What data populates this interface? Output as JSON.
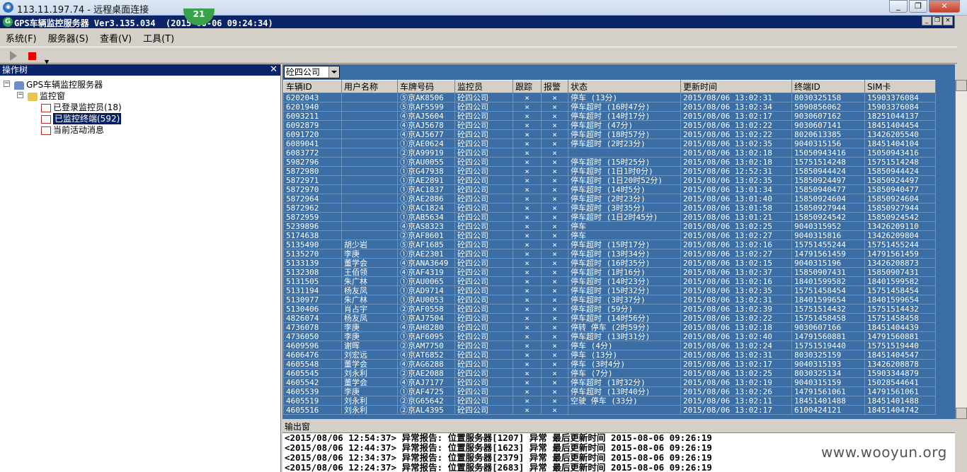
{
  "rdp": {
    "title": "113.11.197.74 - 远程桌面连接",
    "min": "_",
    "restore": "❐",
    "close": "✕"
  },
  "badge": "21",
  "app": {
    "title": "GPS车辆监控服务器 Ver3.135.034  (2015-08-06 09:24:34)"
  },
  "menu": [
    "系统(F)",
    "服务器(S)",
    "查看(V)",
    "工具(T)"
  ],
  "tree": {
    "header": "操作树",
    "root": "GPS车辆监控服务器",
    "monitor": "监控窗",
    "children": [
      "已登录监控员(18)",
      "已监控终端(592)",
      "当前活动消息"
    ]
  },
  "filter": {
    "company": "砼四公司"
  },
  "grid": {
    "columns": [
      "车辆ID",
      "用户名称",
      "车牌号码",
      "监控员",
      "跟踪",
      "报警",
      "状态",
      "更新时间",
      "终端ID",
      "SIM卡"
    ],
    "rows": [
      [
        "6202043",
        "",
        "⑤京AK8506",
        "砼四公司",
        "×",
        "×",
        "停车 (13分)",
        "2015/08/06 13:02:31",
        "8030325158",
        "15903376084"
      ],
      [
        "6201940",
        "",
        "⑤京AF5599",
        "砼四公司",
        "×",
        "×",
        "停车超时 (16时47分)",
        "2015/08/06 13:02:34",
        "5090856062",
        "15903376084"
      ],
      [
        "6093211",
        "",
        "④京AJ5604",
        "砼四公司",
        "×",
        "×",
        "停车超时 (14时17分)",
        "2015/08/06 13:02:17",
        "9030607162",
        "18251044137"
      ],
      [
        "6092879",
        "",
        "④京AJ5678",
        "砼四公司",
        "×",
        "×",
        "停车超时 (47分)",
        "2015/08/06 13:02:22",
        "9030607141",
        "18451404454"
      ],
      [
        "6091720",
        "",
        "④京AJ5677",
        "砼四公司",
        "×",
        "×",
        "停车超时 (18时57分)",
        "2015/08/06 13:02:22",
        "8020613385",
        "13426205540"
      ],
      [
        "6089041",
        "",
        "①京AE0624",
        "砼四公司",
        "×",
        "×",
        "停车超时 (2时23分)",
        "2015/08/06 13:02:35",
        "9040315156",
        "18451404104"
      ],
      [
        "6083772",
        "",
        "②京A99919",
        "砼四公司",
        "×",
        "×",
        "",
        "2015/08/06 13:02:18",
        "15050943416",
        "15050943416"
      ],
      [
        "5982796",
        "",
        "①京AU0055",
        "砼四公司",
        "×",
        "×",
        "停车超时 (15时25分)",
        "2015/08/06 13:02:18",
        "15751514248",
        "15751514248"
      ],
      [
        "5872980",
        "",
        "①京G47938",
        "砼四公司",
        "×",
        "×",
        "停车超时 (1日1时0分)",
        "2015/08/06 12:52:31",
        "15850944424",
        "15850944424"
      ],
      [
        "5872971",
        "",
        "①京AE2891",
        "砼四公司",
        "×",
        "×",
        "停车超时 (1日20时52分)",
        "2015/08/06 13:02:35",
        "15850924497",
        "15850924497"
      ],
      [
        "5872970",
        "",
        "①京AC1837",
        "砼四公司",
        "×",
        "×",
        "停车超时 (14时5分)",
        "2015/08/06 13:01:34",
        "15850940477",
        "15850940477"
      ],
      [
        "5872964",
        "",
        "①京AE2886",
        "砼四公司",
        "×",
        "×",
        "停车超时 (2时23分)",
        "2015/08/06 13:01:40",
        "15850924604",
        "15850924604"
      ],
      [
        "5872962",
        "",
        "①京AC1824",
        "砼四公司",
        "×",
        "×",
        "停车超时 (3时35分)",
        "2015/08/06 13:01:58",
        "15850927944",
        "15850927944"
      ],
      [
        "5872959",
        "",
        "①京AB5634",
        "砼四公司",
        "×",
        "×",
        "停车超时 (1日2时45分)",
        "2015/08/06 13:01:21",
        "15850924542",
        "15850924542"
      ],
      [
        "5239896",
        "",
        "④京AS8323",
        "砼四公司",
        "×",
        "×",
        "停车",
        "2015/08/06 13:02:25",
        "9040315952",
        "13426209110"
      ],
      [
        "5174638",
        "",
        "②京AF8601",
        "砼四公司",
        "×",
        "×",
        "停车",
        "2015/08/06 13:02:27",
        "9040315816",
        "13426209804"
      ],
      [
        "5135490",
        "胡少岩",
        "⑤京AF1685",
        "砼四公司",
        "×",
        "×",
        "停车超时 (15时17分)",
        "2015/08/06 13:02:16",
        "15751455244",
        "15751455244"
      ],
      [
        "5135270",
        "李庚",
        "①京AE2301",
        "砼四公司",
        "×",
        "×",
        "停车超时 (13时34分)",
        "2015/08/06 13:02:27",
        "14791561459",
        "14791561459"
      ],
      [
        "5133139",
        "董学会",
        "④京ANA3649",
        "砼四公司",
        "×",
        "×",
        "停车超时 (16时35分)",
        "2015/08/06 13:02:15",
        "9040315196",
        "13426208873"
      ],
      [
        "5132308",
        "王佰领",
        "④京AF4319",
        "砼四公司",
        "×",
        "×",
        "停车超时 (1时16分)",
        "2015/08/06 13:02:37",
        "15850907431",
        "15850907431"
      ],
      [
        "5131505",
        "朱广林",
        "①京AU0065",
        "砼四公司",
        "×",
        "×",
        "停车超时 (14时23分)",
        "2015/08/06 13:02:16",
        "18401599582",
        "18401599582"
      ],
      [
        "5131194",
        "杨友凤",
        "①京AD9714",
        "砼四公司",
        "×",
        "×",
        "停车超时 (15时32分)",
        "2015/08/06 13:02:35",
        "15751458454",
        "15751458454"
      ],
      [
        "5130977",
        "朱广林",
        "①京AU0053",
        "砼四公司",
        "×",
        "×",
        "停车超时 (3时37分)",
        "2015/08/06 13:02:31",
        "18401599654",
        "18401599654"
      ],
      [
        "5130406",
        "肖占宇",
        "②京AF0558",
        "砼四公司",
        "×",
        "×",
        "停车超时 (59分)",
        "2015/08/06 13:02:39",
        "15751514432",
        "15751514432"
      ],
      [
        "4826074",
        "杨友凤",
        "①京AJ7504",
        "砼四公司",
        "×",
        "×",
        "停车超时 (14时56分)",
        "2015/08/06 13:02:22",
        "15751458458",
        "15751458458"
      ],
      [
        "4736078",
        "李庚",
        "④京AH8280",
        "砼四公司",
        "×",
        "×",
        "停转 停车 (2时59分)",
        "2015/08/06 13:02:18",
        "9030607166",
        "18451404439"
      ],
      [
        "4736050",
        "李庚",
        "①京AF6095",
        "砼四公司",
        "×",
        "×",
        "停车超时 (13时31分)",
        "2015/08/06 13:02:40",
        "14791560881",
        "14791560881"
      ],
      [
        "4609596",
        "谢晖",
        "②京AM7750",
        "砼四公司",
        "×",
        "×",
        "停车 (4分)",
        "2015/08/06 13:02:24",
        "15751519440",
        "15751519440"
      ],
      [
        "4606476",
        "刘宏远",
        "④京AT6852",
        "砼四公司",
        "×",
        "×",
        "停车 (13分)",
        "2015/08/06 13:02:31",
        "8030325159",
        "18451404547"
      ],
      [
        "4605548",
        "董学会",
        "④京AG6288",
        "砼四公司",
        "×",
        "×",
        "停车 (3时4分)",
        "2015/08/06 13:02:17",
        "9040315193",
        "13426208878"
      ],
      [
        "4605545",
        "刘永利",
        "②京AE2088",
        "砼四公司",
        "×",
        "×",
        "停车 (7分)",
        "2015/08/06 13:02:25",
        "8030325134",
        "15903344879"
      ],
      [
        "4605542",
        "董学会",
        "④京AJ7177",
        "砼四公司",
        "×",
        "×",
        "停车超时 (1时32分)",
        "2015/08/06 13:02:19",
        "9040315159",
        "15028544641"
      ],
      [
        "4605539",
        "李庚",
        "①京AF4725",
        "砼四公司",
        "×",
        "×",
        "停车超时 (13时40分)",
        "2015/08/06 13:02:26",
        "14791561061",
        "14791561061"
      ],
      [
        "4605519",
        "刘永利",
        "②京G65642",
        "砼四公司",
        "×",
        "×",
        "空驶 停车 (33分)",
        "2015/08/06 13:02:11",
        "18451401488",
        "18451401488"
      ],
      [
        "4605516",
        "刘永利",
        "②京AL4395",
        "砼四公司",
        "×",
        "×",
        "",
        "2015/08/06 13:02:17",
        "6100424121",
        "18451404742"
      ]
    ]
  },
  "output": {
    "header": "输出窗",
    "lines": [
      "<2015/08/06 12:54:37> 异常报告: 位置服务器[1207] 异常 最后更新时间 2015-08-06 09:26:19",
      "<2015/08/06 12:44:37> 异常报告: 位置服务器[1623] 异常 最后更新时间 2015-08-06 09:26:19",
      "<2015/08/06 12:34:37> 异常报告: 位置服务器[2379] 异常 最后更新时间 2015-08-06 09:26:19",
      "<2015/08/06 12:24:37> 异常报告: 位置服务器[2683] 异常 最后更新时间 2015-08-06 09:26:19"
    ]
  },
  "watermark": "www.wooyun.org"
}
